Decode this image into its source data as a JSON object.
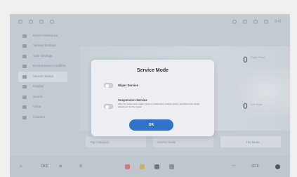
{
  "status_bar": {
    "time": "9:41"
  },
  "sidebar": {
    "items": [
      {
        "label": "Driver Assistance",
        "icon": "steering-icon"
      },
      {
        "label": "Vehicle Settings",
        "icon": "car-icon"
      },
      {
        "label": "Safe Settings",
        "icon": "shield-icon"
      },
      {
        "label": "Environment Condition",
        "icon": "leaf-icon"
      },
      {
        "label": "Vehicle Status",
        "icon": "vehicle-status-icon"
      },
      {
        "label": "Display",
        "icon": "display-icon"
      },
      {
        "label": "Sound",
        "icon": "sound-icon"
      },
      {
        "label": "Voice",
        "icon": "mic-icon"
      },
      {
        "label": "Connect",
        "icon": "link-icon"
      }
    ]
  },
  "background_panel": {
    "top_label": "Maintenance",
    "tire_front_right": "0",
    "tire_rear_right": "0",
    "front_right_label": "Right Front",
    "rear_right_label": "Left Rear"
  },
  "background_dropdowns": {
    "trip_computer": "Trip Computer",
    "service_mode": "Service Mode",
    "third": "Tire Mode"
  },
  "taskbar": {
    "left_temp": "OFF",
    "right_temp": "OFF"
  },
  "modal": {
    "title": "Service Mode",
    "options": [
      {
        "label": "Wiper Service",
        "description": ""
      },
      {
        "label": "Suspension Service",
        "description": "After the suspension repair mode is enabled the vehicle system prohibits body height adjustment for the repair."
      }
    ],
    "ok_label": "OK"
  },
  "colors": {
    "primary_button": "#2f74c9",
    "modal_bg": "#eceef1",
    "backdrop": "#cfd6dd"
  }
}
